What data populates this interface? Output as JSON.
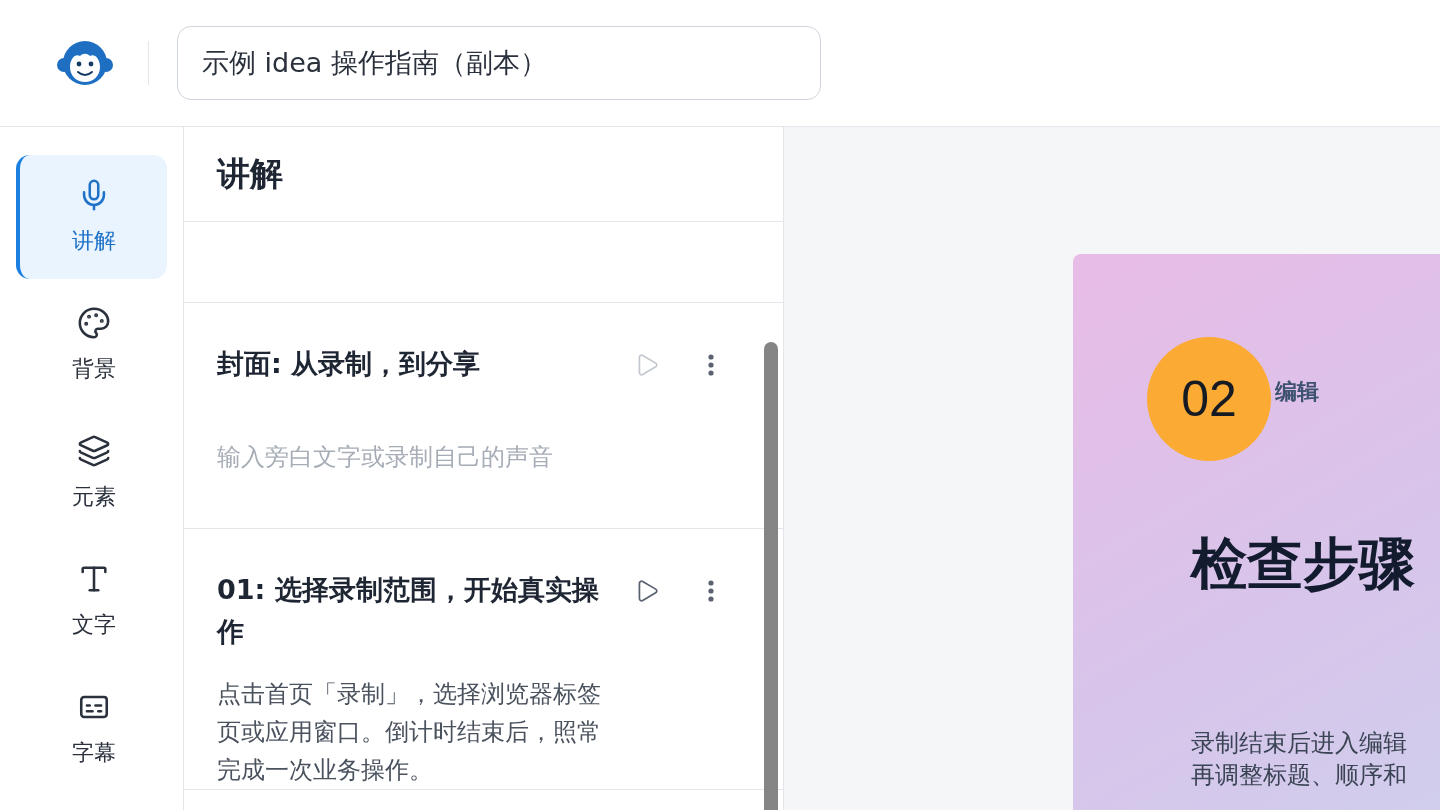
{
  "header": {
    "title_field": {
      "value": "示例 idea 操作指南（副本）"
    }
  },
  "nav": [
    {
      "kind": "mic",
      "label": "讲解",
      "selected": true
    },
    {
      "kind": "palette",
      "label": "背景",
      "selected": false
    },
    {
      "kind": "layers",
      "label": "元素",
      "selected": false
    },
    {
      "kind": "type",
      "label": "文字",
      "selected": false
    },
    {
      "kind": "captions",
      "label": "字幕",
      "selected": false
    }
  ],
  "panel": {
    "title": "讲解",
    "cards": [
      {
        "title": "封面: 从录制，到分享",
        "play_disabled": true,
        "placeholder": "输入旁白文字或录制自己的声音"
      },
      {
        "title": "01: 选择录制范围，开始真实操作",
        "play_disabled": false,
        "text": "点击首页「录制」，选择浏览器标签页或应用窗口。倒计时结束后，照常完成一次业务操作。"
      }
    ]
  },
  "slide": {
    "number": "02",
    "section": "编辑",
    "title": "检查步骤",
    "body": [
      "录制结束后进入编辑",
      "再调整标题、顺序和"
    ]
  }
}
